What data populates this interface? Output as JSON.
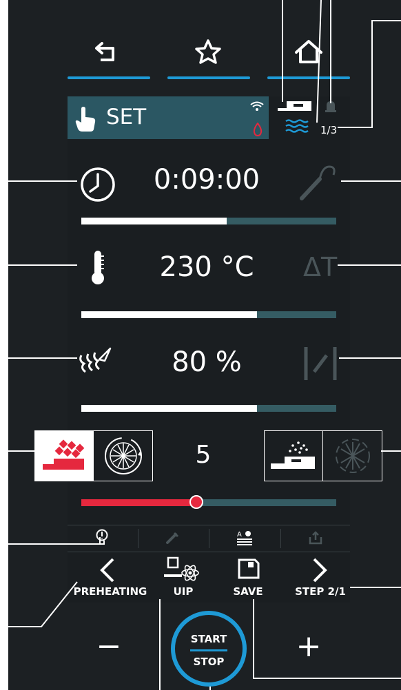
{
  "header": {
    "mode_label": "SET",
    "steps": "1/3"
  },
  "time": {
    "value": "0:09:00",
    "progress": 0.57
  },
  "temperature": {
    "value": "230 °C",
    "delta_label": "ΔT",
    "progress": 0.69
  },
  "humidity": {
    "value": "80 %",
    "progress": 0.69
  },
  "fan": {
    "speed_value": "5",
    "slider_level": 0.45
  },
  "bottom_nav": {
    "preheating": "PREHEATING",
    "uip": "UIP",
    "save": "SAVE",
    "step": "STEP 2/1"
  },
  "start_stop": {
    "start": "START",
    "stop": "STOP"
  },
  "controls": {
    "minus": "−",
    "plus": "+"
  },
  "colors": {
    "accent": "#1e9ad6",
    "red": "#e5283e",
    "bg": "#1c2023",
    "header": "#2b5763",
    "track": "#355c63"
  }
}
